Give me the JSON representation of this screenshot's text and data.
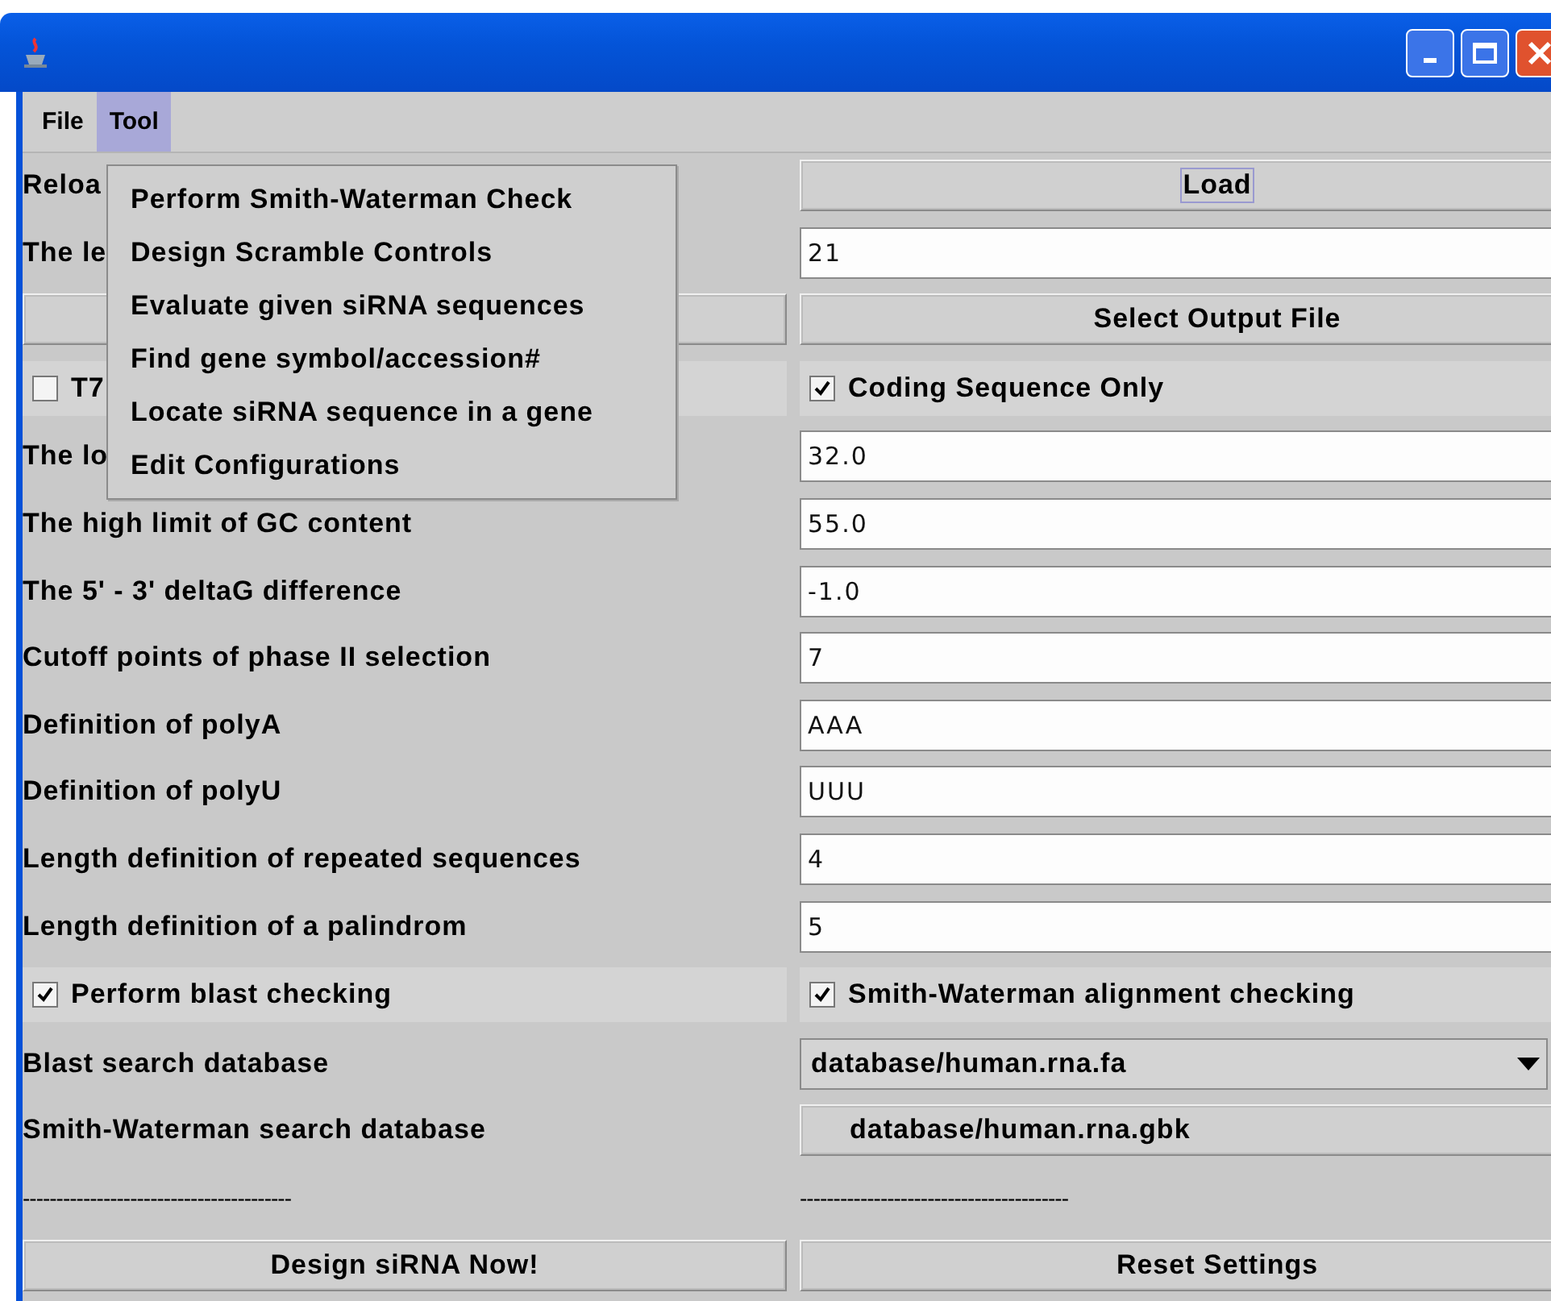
{
  "menu_bar": [
    {
      "label": "File",
      "selected": false
    },
    {
      "label": "Tool",
      "selected": true
    }
  ],
  "tool_menu": [
    "Perform Smith-Waterman Check",
    "Design Scramble Controls",
    "Evaluate given siRNA sequences",
    "Find gene symbol/accession#",
    "Locate siRNA sequence in a gene",
    "Edit Configurations"
  ],
  "rows": [
    [
      {
        "kind": "label",
        "text": "Reloa"
      },
      {
        "kind": "button",
        "text": "Load",
        "focused": true
      }
    ],
    [
      {
        "kind": "label",
        "text": "The le"
      },
      {
        "kind": "field",
        "value": "21"
      }
    ],
    [
      {
        "kind": "button",
        "text": ""
      },
      {
        "kind": "button",
        "text": "Select Output File",
        "focused": false
      }
    ],
    [
      {
        "kind": "checkbox",
        "text": "T7",
        "checked": false
      },
      {
        "kind": "checkbox",
        "text": "Coding Sequence Only",
        "checked": true
      }
    ],
    [
      {
        "kind": "label",
        "text": "The lo"
      },
      {
        "kind": "field",
        "value": "32.0"
      }
    ],
    [
      {
        "kind": "label",
        "text": "The high limit of GC content"
      },
      {
        "kind": "field",
        "value": "55.0"
      }
    ],
    [
      {
        "kind": "label",
        "text": "The 5' - 3' deltaG difference"
      },
      {
        "kind": "field",
        "value": "-1.0"
      }
    ],
    [
      {
        "kind": "label",
        "text": "Cutoff points of phase II selection"
      },
      {
        "kind": "field",
        "value": "7"
      }
    ],
    [
      {
        "kind": "label",
        "text": "Definition of polyA"
      },
      {
        "kind": "field",
        "value": "AAA"
      }
    ],
    [
      {
        "kind": "label",
        "text": "Definition of polyU"
      },
      {
        "kind": "field",
        "value": "UUU"
      }
    ],
    [
      {
        "kind": "label",
        "text": "Length definition of repeated sequences"
      },
      {
        "kind": "field",
        "value": "4"
      }
    ],
    [
      {
        "kind": "label",
        "text": "Length definition of a palindrom"
      },
      {
        "kind": "field",
        "value": "5"
      }
    ],
    [
      {
        "kind": "checkbox",
        "text": "Perform blast checking",
        "checked": true
      },
      {
        "kind": "checkbox",
        "text": "Smith-Waterman alignment checking",
        "checked": true
      }
    ],
    [
      {
        "kind": "label",
        "text": "Blast search database"
      },
      {
        "kind": "combo",
        "value": "database/human.rna.fa"
      }
    ],
    [
      {
        "kind": "label",
        "text": "Smith-Waterman search database"
      },
      {
        "kind": "path_button",
        "text": "database/human.rna.gbk"
      }
    ],
    [
      {
        "kind": "dashes",
        "text": "----------------------------------------"
      },
      {
        "kind": "dashes",
        "text": "----------------------------------------"
      }
    ],
    [
      {
        "kind": "button",
        "text": "Design siRNA Now!",
        "focused": false
      },
      {
        "kind": "button",
        "text": "Reset Settings",
        "focused": false
      }
    ]
  ]
}
